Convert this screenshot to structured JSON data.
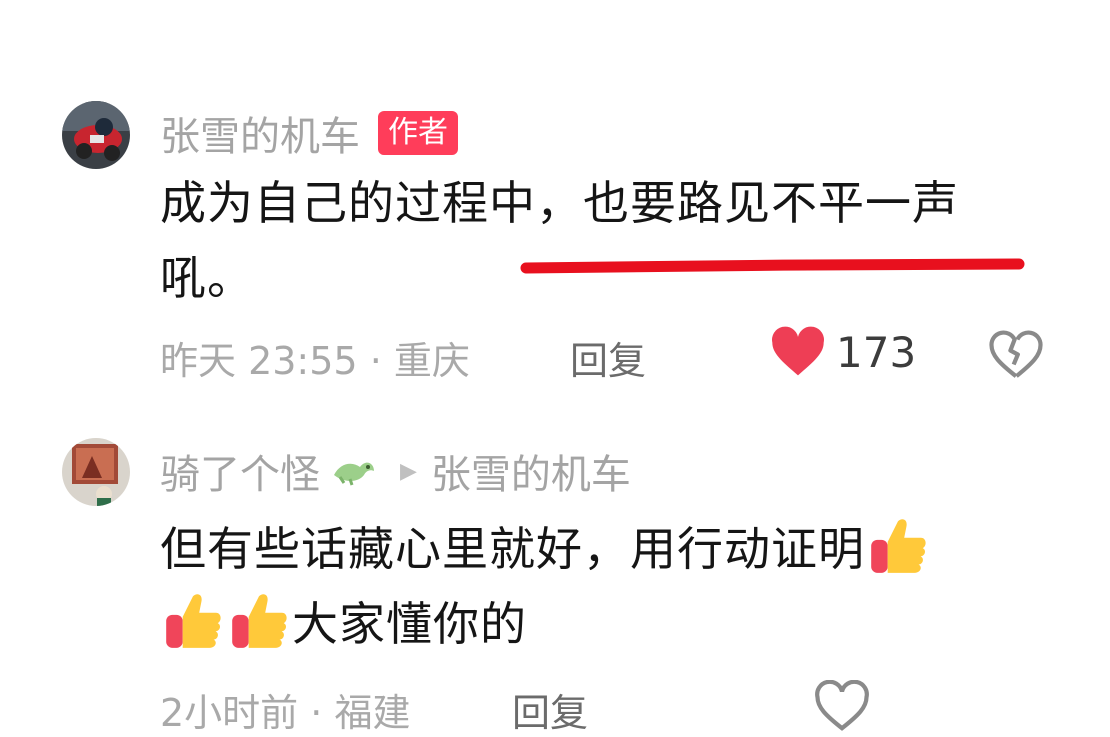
{
  "comments": [
    {
      "username": "张雪的机车",
      "badge": "作者",
      "text_line1": "成为自己的过程中，也要路见不平一声",
      "text_line2": "吼。",
      "time": "昨天 23:55",
      "location": "重庆",
      "reply_label": "回复",
      "likes": "173",
      "liked": true,
      "like_color": "#ee3e55"
    },
    {
      "username": "骑了个怪",
      "reply_to": "张雪的机车",
      "text_line1": "但有些话藏心里就好，用行动证明",
      "text_line2": "大家懂你的",
      "time": "2小时前",
      "location": "福建",
      "reply_label": "回复"
    }
  ],
  "colors": {
    "badge_bg": "#ff3d5a",
    "underline": "#e8101e",
    "meta_text": "#a9a9a9"
  },
  "icons": [
    "heart-icon",
    "broken-heart-icon",
    "thumbs-up-icon",
    "dragon-emoji-icon",
    "play-arrow-icon"
  ]
}
